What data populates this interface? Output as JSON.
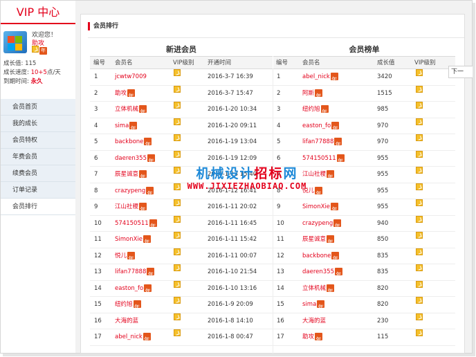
{
  "sidebar": {
    "title": "VIP 中心",
    "welcome": "欢迎您！",
    "username": "助攻",
    "growth_value_label": "成长值:",
    "growth_value": "115",
    "growth_speed_label": "成长速度:",
    "growth_speed": "10+5",
    "growth_speed_unit": "点/天",
    "expire_label": "到期时间:",
    "expire_value": "永久",
    "nav": [
      {
        "label": "会员首页"
      },
      {
        "label": "我的成长"
      },
      {
        "label": "会员特权"
      },
      {
        "label": "年费会员"
      },
      {
        "label": "续费会员"
      },
      {
        "label": "订单记录"
      },
      {
        "label": "会员排行"
      }
    ]
  },
  "main": {
    "section_title": "会员排行",
    "year_badge": "年",
    "new_members": {
      "title": "新进会员",
      "headers": [
        "编号",
        "会员名",
        "VIP级别",
        "开通时间"
      ],
      "rows": [
        {
          "no": "1",
          "name": "jcwtw7009",
          "year": false,
          "time": "2016-3-7 16:39"
        },
        {
          "no": "2",
          "name": "助攻",
          "year": true,
          "time": "2016-3-7 15:47"
        },
        {
          "no": "3",
          "name": "立体机械",
          "year": true,
          "time": "2016-1-20 10:34"
        },
        {
          "no": "4",
          "name": "sima",
          "year": true,
          "time": "2016-1-20 09:11"
        },
        {
          "no": "5",
          "name": "backbone",
          "year": true,
          "time": "2016-1-19 13:04"
        },
        {
          "no": "6",
          "name": "daeren355",
          "year": true,
          "time": "2016-1-19 12:09"
        },
        {
          "no": "7",
          "name": "辰星诚意",
          "year": true,
          "time": "2016-1-13 15:40"
        },
        {
          "no": "8",
          "name": "crazypeng",
          "year": true,
          "time": "2016-1-12 16:41"
        },
        {
          "no": "9",
          "name": "江山社稷",
          "year": true,
          "time": "2016-1-11 20:02"
        },
        {
          "no": "10",
          "name": "574150511",
          "year": true,
          "time": "2016-1-11 16:45"
        },
        {
          "no": "11",
          "name": "SimonXie",
          "year": true,
          "time": "2016-1-11 15:42"
        },
        {
          "no": "12",
          "name": "悦儿",
          "year": true,
          "time": "2016-1-11 00:07"
        },
        {
          "no": "13",
          "name": "lifan77888",
          "year": true,
          "time": "2016-1-10 21:54"
        },
        {
          "no": "14",
          "name": "easton_fo",
          "year": true,
          "time": "2016-1-10 13:16"
        },
        {
          "no": "15",
          "name": "纽约旭",
          "year": true,
          "time": "2016-1-9 20:09"
        },
        {
          "no": "16",
          "name": "大海的蓝",
          "year": false,
          "time": "2016-1-8 14:10"
        },
        {
          "no": "17",
          "name": "abel_nick",
          "year": true,
          "time": "2016-1-8 00:47"
        }
      ]
    },
    "ranking": {
      "title": "会员榜单",
      "headers": [
        "编号",
        "会员名",
        "成长值",
        "VIP级别"
      ],
      "rows": [
        {
          "no": "1",
          "name": "abel_nick",
          "year": true,
          "value": "3420"
        },
        {
          "no": "2",
          "name": "阿斯",
          "year": true,
          "value": "1515"
        },
        {
          "no": "3",
          "name": "纽约旭",
          "year": true,
          "value": "985"
        },
        {
          "no": "4",
          "name": "easton_fo",
          "year": true,
          "value": "970"
        },
        {
          "no": "5",
          "name": "lifan77888",
          "year": true,
          "value": "970"
        },
        {
          "no": "6",
          "name": "574150511",
          "year": true,
          "value": "955"
        },
        {
          "no": "7",
          "name": "江山社稷",
          "year": true,
          "value": "955"
        },
        {
          "no": "8",
          "name": "悦儿",
          "year": true,
          "value": "955"
        },
        {
          "no": "9",
          "name": "SimonXie",
          "year": true,
          "value": "955"
        },
        {
          "no": "10",
          "name": "crazypeng",
          "year": true,
          "value": "940"
        },
        {
          "no": "11",
          "name": "辰星诚意",
          "year": true,
          "value": "850"
        },
        {
          "no": "12",
          "name": "backbone",
          "year": true,
          "value": "835"
        },
        {
          "no": "13",
          "name": "daeren355",
          "year": true,
          "value": "835"
        },
        {
          "no": "14",
          "name": "立体机械",
          "year": true,
          "value": "820"
        },
        {
          "no": "15",
          "name": "sima",
          "year": true,
          "value": "820"
        },
        {
          "no": "16",
          "name": "大海的蓝",
          "year": false,
          "value": "230"
        },
        {
          "no": "17",
          "name": "助攻",
          "year": true,
          "value": "115"
        }
      ]
    }
  },
  "popup_text": "下一",
  "watermark": {
    "text_cn_a": "机械设计",
    "text_cn_b": "招标",
    "text_cn_c": "网",
    "text_en": "WWW.JIXIEZHAOBIAQ.COM"
  },
  "colors": {
    "accent": "#e3001b",
    "nav_bg": "#eaf0f6",
    "vip_icon": "#f5c02b",
    "year_badge": "#e3561b",
    "watermark_blue": "#1f8ad8"
  }
}
